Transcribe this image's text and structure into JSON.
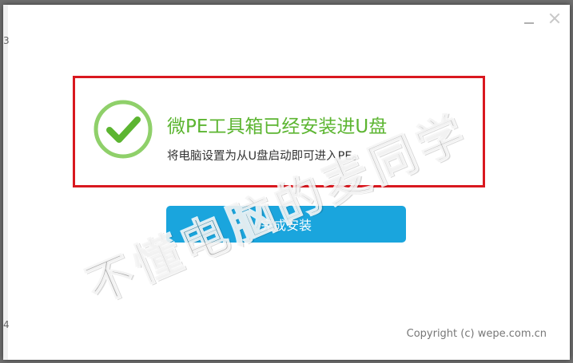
{
  "window": {
    "edge_numbers": [
      "3",
      "4"
    ]
  },
  "message": {
    "title": "微PE工具箱已经安装进U盘",
    "subtitle": "将电脑设置为从U盘启动即可进入PE。"
  },
  "actions": {
    "finish_label": "完成安装"
  },
  "watermark": {
    "text": "不懂电脑的麦同学"
  },
  "footer": {
    "copyright": "Copyright (c) wepe.com.cn"
  },
  "colors": {
    "success_green": "#5cb531",
    "button_blue": "#1aa5dd",
    "highlight_red": "#d9181f"
  },
  "icons": {
    "success": "check-circle-icon",
    "minimize": "minimize-icon",
    "close": "close-icon"
  }
}
